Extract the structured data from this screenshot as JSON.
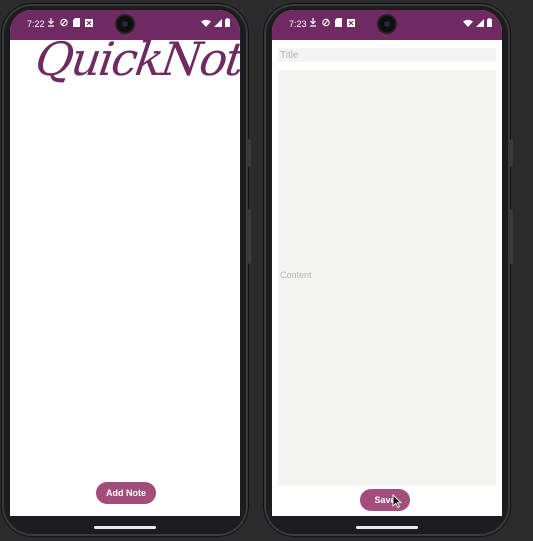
{
  "left_phone": {
    "status": {
      "time": "7:22"
    },
    "logo": "QuickNote",
    "add_note_label": "Add Note"
  },
  "right_phone": {
    "status": {
      "time": "7:23"
    },
    "title_placeholder": "Title",
    "content_placeholder": "Content",
    "save_label": "Save"
  },
  "colors": {
    "statusbar": "#6f2a62",
    "accent_button": "#a24d7a",
    "field_bg": "#f4f5f0"
  },
  "icons": {
    "status_left": [
      "download-icon",
      "shield-icon",
      "sd-card-icon",
      "close-box-icon"
    ],
    "status_right": [
      "wifi-icon",
      "signal-icon",
      "battery-icon"
    ]
  }
}
